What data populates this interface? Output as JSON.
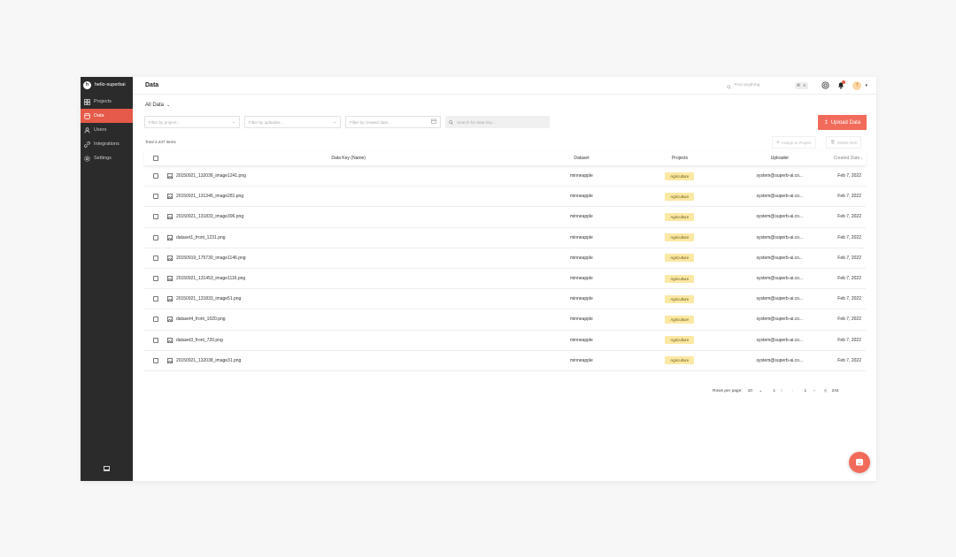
{
  "workspace": {
    "avatar_letter": "h",
    "name": "hello-superbai"
  },
  "sidebar": {
    "items": [
      {
        "label": "Projects",
        "icon": "projects-icon",
        "active": false
      },
      {
        "label": "Data",
        "icon": "data-icon",
        "active": true
      },
      {
        "label": "Users",
        "icon": "users-icon",
        "active": false
      },
      {
        "label": "Integrations",
        "icon": "integrations-icon",
        "active": false
      },
      {
        "label": "Settings",
        "icon": "settings-icon",
        "active": false
      }
    ]
  },
  "header": {
    "title": "Data",
    "search_placeholder": "Find anything",
    "search_shortcut": "⌘ K",
    "user_initial": "T"
  },
  "view_selector": {
    "label": "All Data"
  },
  "filters": {
    "project_placeholder": "Filter by project...",
    "uploader_placeholder": "Filter by uploader...",
    "date_placeholder": "Filter by created date...",
    "data_key_placeholder": "Search for data key..."
  },
  "upload_button": {
    "label": "Upload Data"
  },
  "summary": {
    "total": "Total 2,437 items"
  },
  "bulk_actions": {
    "assign": "Assign to Project",
    "delete": "Delete item"
  },
  "table": {
    "headers": {
      "data_key": "Data Key (Name)",
      "dataset": "Dataset",
      "projects": "Projects",
      "uploader": "Uploader",
      "created": "Created Date"
    },
    "rows": [
      {
        "key": "20150921_132036_image1241.png",
        "dataset": "minneapple",
        "project": "Agriculture",
        "uploader": "system@superb-ai.co...",
        "date": "Feb 7, 2022"
      },
      {
        "key": "20150921_131346_image281.png",
        "dataset": "minneapple",
        "project": "Agriculture",
        "uploader": "system@superb-ai.co...",
        "date": "Feb 7, 2022"
      },
      {
        "key": "20150921_131833_image396.png",
        "dataset": "minneapple",
        "project": "Agriculture",
        "uploader": "system@superb-ai.co...",
        "date": "Feb 7, 2022"
      },
      {
        "key": "dataset1_front_1231.png",
        "dataset": "minneapple",
        "project": "Agriculture",
        "uploader": "system@superb-ai.co...",
        "date": "Feb 7, 2022"
      },
      {
        "key": "20150919_175730_image1146.png",
        "dataset": "minneapple",
        "project": "Agriculture",
        "uploader": "system@superb-ai.co...",
        "date": "Feb 7, 2022"
      },
      {
        "key": "20150921_131453_image1116.png",
        "dataset": "minneapple",
        "project": "Agriculture",
        "uploader": "system@superb-ai.co...",
        "date": "Feb 7, 2022"
      },
      {
        "key": "20150921_131833_image51.png",
        "dataset": "minneapple",
        "project": "Agriculture",
        "uploader": "system@superb-ai.co...",
        "date": "Feb 7, 2022"
      },
      {
        "key": "dataset4_front_1020.png",
        "dataset": "minneapple",
        "project": "Agriculture",
        "uploader": "system@superb-ai.co...",
        "date": "Feb 7, 2022"
      },
      {
        "key": "dataset3_front_720.png",
        "dataset": "minneapple",
        "project": "Agriculture",
        "uploader": "system@superb-ai.co...",
        "date": "Feb 7, 2022"
      },
      {
        "key": "20150921_132038_image31.png",
        "dataset": "minneapple",
        "project": "Agriculture",
        "uploader": "system@superb-ai.co...",
        "date": "Feb 7, 2022"
      }
    ]
  },
  "pagination": {
    "rows_label": "Rows per page:",
    "rows_value": "10",
    "current_page": "1",
    "page_input": "1",
    "total_pages": "244"
  },
  "colors": {
    "accent": "#f26b5a",
    "sidebar_bg": "#2b2b2b",
    "tag_bg": "#fbe8a3"
  }
}
